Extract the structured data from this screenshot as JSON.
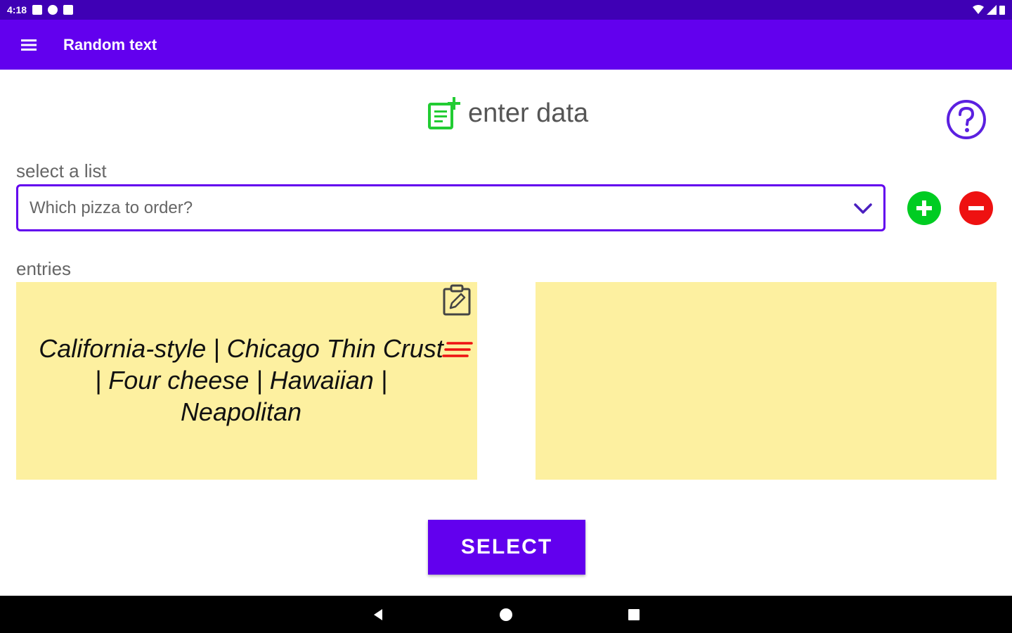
{
  "status_bar": {
    "time": "4:18"
  },
  "app_bar": {
    "title": "Random text",
    "menu_icon": "hamburger-menu-icon"
  },
  "header": {
    "title": "enter data",
    "icon": "add-note-icon",
    "help_icon": "help-circle-icon"
  },
  "list_section": {
    "label": "select a list",
    "selected_value": "Which pizza to order?"
  },
  "entries_section": {
    "label": "entries",
    "text": "California-style | Chicago Thin Crust | Four cheese | Hawaiian | Neapolitan"
  },
  "select_button": {
    "label": "SELECT"
  },
  "colors": {
    "primary": "#6200ee",
    "status_bar": "#3f00b5",
    "card_background": "#fdf0a0",
    "add_green": "#00cc22",
    "remove_red": "#ee1111"
  }
}
